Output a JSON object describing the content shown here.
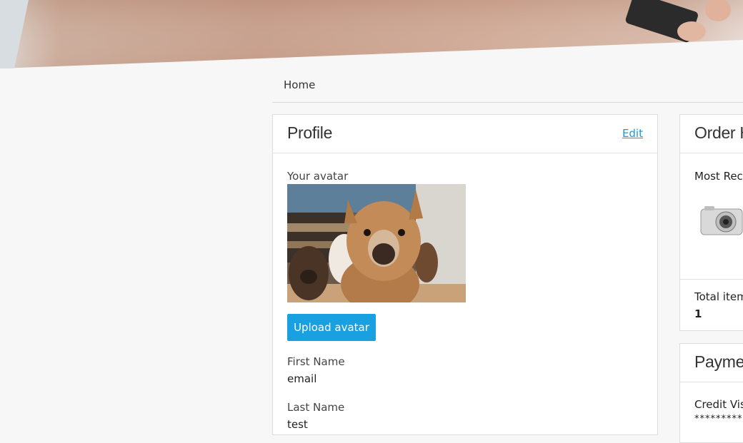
{
  "breadcrumb": {
    "home": "Home"
  },
  "profile": {
    "title": "Profile",
    "edit_label": "Edit",
    "avatar_label": "Your avatar",
    "upload_label": "Upload avatar",
    "fields": [
      {
        "label": "First Name",
        "value": "email"
      },
      {
        "label": "Last Name",
        "value": "test"
      }
    ]
  },
  "order_history": {
    "title": "Order H",
    "most_recent_label": "Most Rece",
    "total_items_label": "Total item",
    "total_items_value": "1"
  },
  "payment": {
    "title": "Paymer",
    "credit_label": "Credit Vis",
    "card_masked": "************"
  },
  "colors": {
    "accent": "#19a0e0",
    "link": "#1a9ad6",
    "background": "#f7f7f7"
  }
}
